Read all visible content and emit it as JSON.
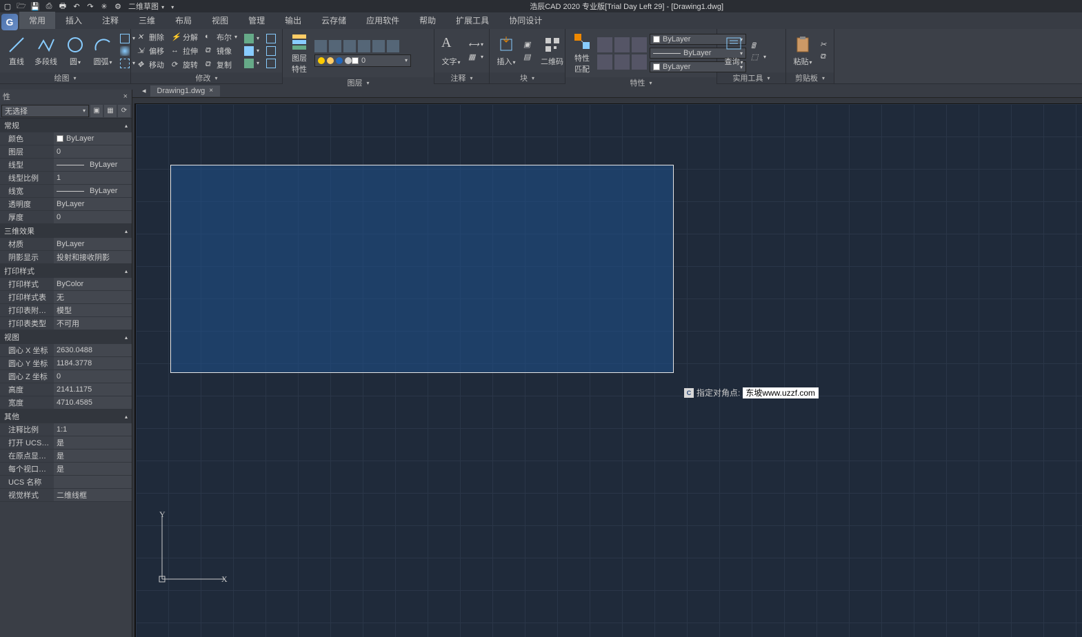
{
  "title": "浩辰CAD 2020 专业版[Trial Day Left 29] - [Drawing1.dwg]",
  "quickDropdown": "二维草图",
  "tabs": [
    "常用",
    "插入",
    "注释",
    "三维",
    "布局",
    "视图",
    "管理",
    "输出",
    "云存储",
    "应用软件",
    "帮助",
    "扩展工具",
    "协同设计"
  ],
  "activeTab": 0,
  "docTab": "Drawing1.dwg",
  "ribbon": {
    "draw": {
      "title": "绘图",
      "line": "直线",
      "polyline": "多段线",
      "circle": "圆",
      "arc": "圆弧"
    },
    "modify": {
      "title": "修改",
      "delete": "删除",
      "explode": "分解",
      "bool": "布尔",
      "offset": "偏移",
      "stretch": "拉伸",
      "mirror": "镜像",
      "move": "移动",
      "rotate": "旋转",
      "copy": "复制"
    },
    "layer": {
      "title": "图层",
      "big": "图层\n特性",
      "current": "0"
    },
    "annotate": {
      "title": "注释",
      "text": "文字"
    },
    "block": {
      "title": "块",
      "insert": "插入",
      "qr": "二维码"
    },
    "props": {
      "title": "特性",
      "match": "特性\n匹配",
      "v1": "ByLayer",
      "v2": "ByLayer",
      "v3": "ByLayer"
    },
    "tools": {
      "title": "实用工具",
      "query": "查询"
    },
    "clip": {
      "title": "剪贴板",
      "paste": "粘贴"
    }
  },
  "propsPanel": {
    "header": "性",
    "selection": "无选择",
    "groups": [
      {
        "name": "常规",
        "rows": [
          {
            "k": "颜色",
            "v": "ByLayer",
            "swatch": true
          },
          {
            "k": "图层",
            "v": "0"
          },
          {
            "k": "线型",
            "v": "ByLayer",
            "line": true
          },
          {
            "k": "线型比例",
            "v": "1"
          },
          {
            "k": "线宽",
            "v": "ByLayer",
            "line": true
          },
          {
            "k": "透明度",
            "v": "ByLayer"
          },
          {
            "k": "厚度",
            "v": "0"
          }
        ]
      },
      {
        "name": "三维效果",
        "rows": [
          {
            "k": "材质",
            "v": "ByLayer"
          },
          {
            "k": "阴影显示",
            "v": "投射和接收阴影"
          }
        ]
      },
      {
        "name": "打印样式",
        "rows": [
          {
            "k": "打印样式",
            "v": "ByColor"
          },
          {
            "k": "打印样式表",
            "v": "无"
          },
          {
            "k": "打印表附…",
            "v": "模型"
          },
          {
            "k": "打印表类型",
            "v": "不可用"
          }
        ]
      },
      {
        "name": "视图",
        "rows": [
          {
            "k": "圆心 X 坐标",
            "v": "2630.0488"
          },
          {
            "k": "圆心 Y 坐标",
            "v": "1184.3778"
          },
          {
            "k": "圆心 Z 坐标",
            "v": "0"
          },
          {
            "k": "高度",
            "v": "2141.1175"
          },
          {
            "k": "宽度",
            "v": "4710.4585"
          }
        ]
      },
      {
        "name": "其他",
        "rows": [
          {
            "k": "注释比例",
            "v": "1:1"
          },
          {
            "k": "打开 UCS…",
            "v": "是"
          },
          {
            "k": "在原点显…",
            "v": "是"
          },
          {
            "k": "每个视口…",
            "v": "是"
          },
          {
            "k": "UCS 名称",
            "v": ""
          },
          {
            "k": "视觉样式",
            "v": "二维线框"
          }
        ]
      }
    ]
  },
  "command": {
    "prompt": "指定对角点:",
    "value": "东坡www.uzzf.com"
  }
}
